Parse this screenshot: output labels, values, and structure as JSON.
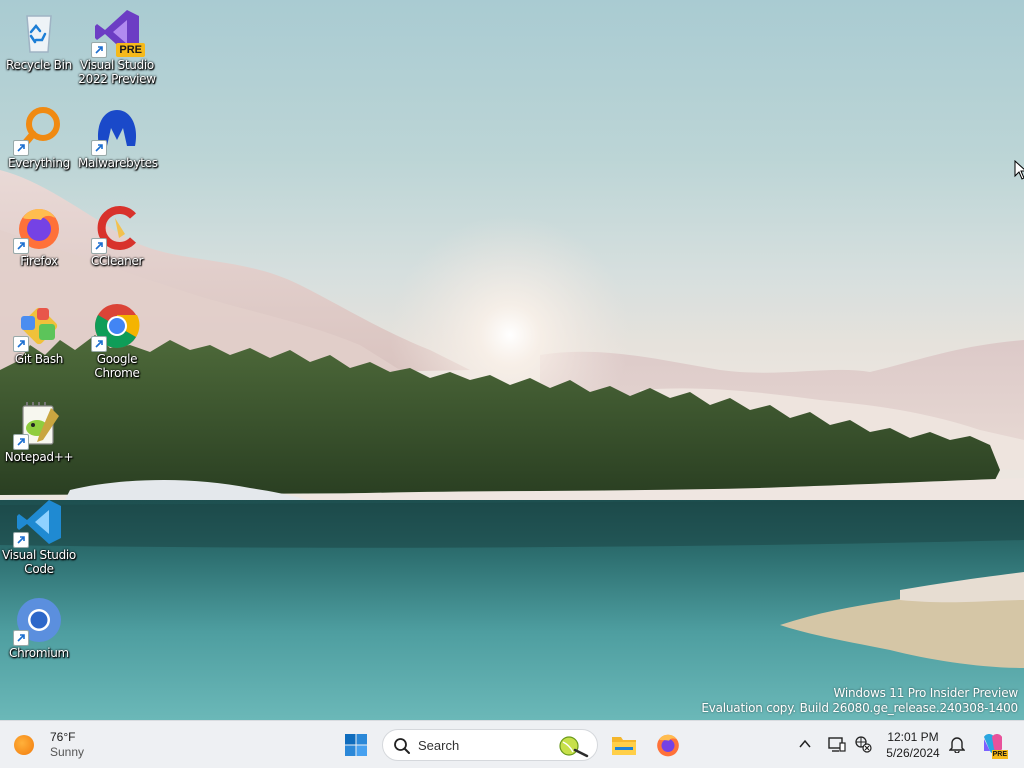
{
  "desktop": {
    "icons": [
      {
        "label": "Recycle Bin"
      },
      {
        "label": "Visual Studio 2022 Preview",
        "badge": "PRE"
      },
      {
        "label": "Everything"
      },
      {
        "label": "Malwarebytes"
      },
      {
        "label": "Firefox"
      },
      {
        "label": "CCleaner"
      },
      {
        "label": "Git Bash"
      },
      {
        "label": "Google Chrome"
      },
      {
        "label": "Notepad++"
      },
      {
        "label": "Visual Studio Code"
      },
      {
        "label": "Chromium"
      }
    ],
    "watermark": {
      "line1": "Windows 11 Pro Insider Preview",
      "line2": "Evaluation copy. Build 26080.ge_release.240308-1400"
    }
  },
  "taskbar": {
    "weather": {
      "temperature": "76°F",
      "condition": "Sunny",
      "icon": "sun-icon"
    },
    "search": {
      "placeholder": "Search"
    },
    "pinned": [
      "start-icon",
      "file-explorer-icon",
      "firefox-icon"
    ],
    "tray": {
      "icons": [
        "chevron-up-icon",
        "display-icon",
        "network-icon",
        "notification-bell-icon",
        "copilot-icon"
      ],
      "time": "12:01 PM",
      "date": "5/26/2024",
      "copilot_badge": "PRE"
    }
  },
  "colors": {
    "taskbar_bg": "#eef0f3",
    "accent": "#0078d4"
  }
}
